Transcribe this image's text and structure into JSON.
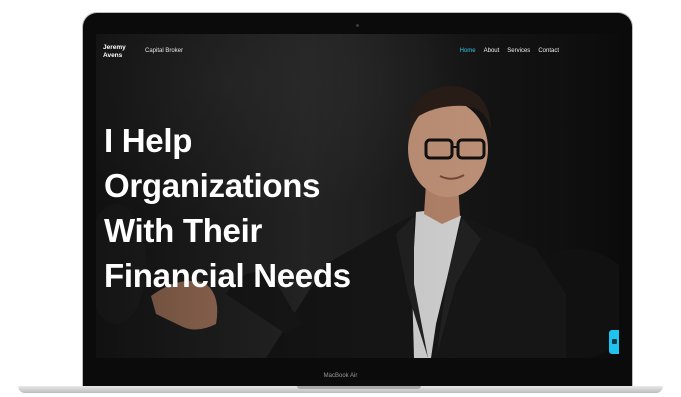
{
  "site": {
    "brand_line1": "Jeremy",
    "brand_line2": "Avens",
    "tagline": "Capital Broker",
    "nav": [
      "Home",
      "About",
      "Services",
      "Contact"
    ],
    "active_nav": "Home"
  },
  "hero": {
    "line1": "I Help",
    "line2": "Organizations",
    "line3": "With Their",
    "line4": "Financial Needs"
  },
  "device": {
    "label": "MacBook Air"
  },
  "colors": {
    "accent": "#35c6e8",
    "chat": "#1ec3f0"
  }
}
